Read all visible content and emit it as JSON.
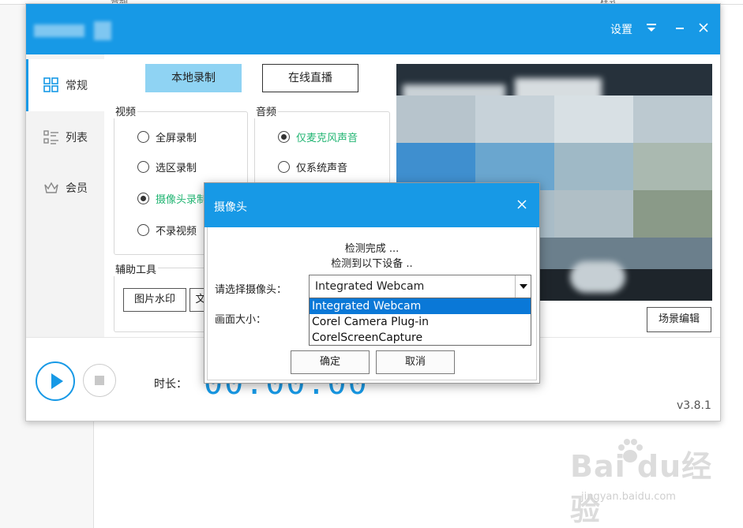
{
  "background": {
    "top_fragments": [
      "音频",
      "样式"
    ]
  },
  "window": {
    "settings_label": "设置",
    "sidebar": [
      {
        "label": "常规",
        "icon": "grid-icon",
        "active": true
      },
      {
        "label": "列表",
        "icon": "list-icon",
        "active": false
      },
      {
        "label": "会员",
        "icon": "crown-icon",
        "active": false
      }
    ],
    "mode_tabs": {
      "local": "本地录制",
      "live": "在线直播"
    },
    "video": {
      "title": "视频",
      "options": [
        {
          "label": "全屏录制",
          "selected": false
        },
        {
          "label": "选区录制",
          "selected": false
        },
        {
          "label": "摄像头录制",
          "selected": true
        },
        {
          "label": "不录视频",
          "selected": false
        }
      ]
    },
    "audio": {
      "title": "音频",
      "options": [
        {
          "label": "仅麦克风声音",
          "selected": true
        },
        {
          "label": "仅系统声音",
          "selected": false
        }
      ]
    },
    "tools": {
      "title": "辅助工具",
      "buttons": [
        "图片水印",
        "文"
      ]
    },
    "scene_edit": "场景编辑",
    "duration_label": "时长：",
    "timer": "00:00:00",
    "version": "v3.8.1"
  },
  "dialog": {
    "title": "摄像头",
    "msg1": "检测完成 ...",
    "msg2": "检测到以下设备 ..",
    "select_label": "请选择摄像头：",
    "size_label": "画面大小：",
    "selected_device": "Integrated Webcam",
    "devices": [
      "Integrated Webcam",
      "Corel Camera Plug-in",
      "CorelScreenCapture"
    ],
    "ok": "确定",
    "cancel": "取消"
  },
  "watermark": {
    "logo": "Bai  du经验",
    "url": "jingyan.baidu.com"
  },
  "colors": {
    "accent": "#1799e6",
    "green": "#22b573",
    "select_blue": "#0a78d7"
  }
}
